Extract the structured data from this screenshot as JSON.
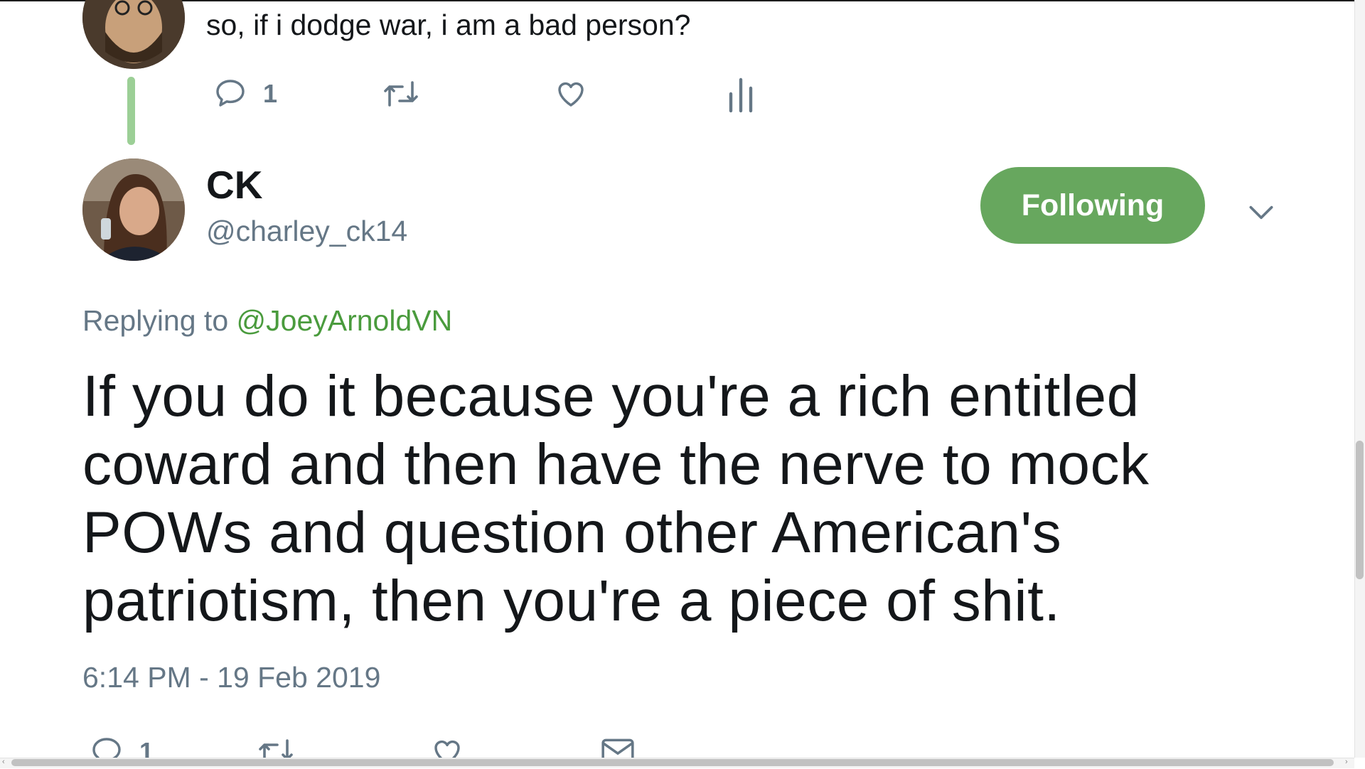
{
  "previous_tweet": {
    "text": "so, if i dodge war, i am a bad person?",
    "reply_count": "1"
  },
  "reply_tweet": {
    "display_name": "CK",
    "handle": "@charley_ck14",
    "follow_label": "Following",
    "replying_prefix": "Replying to ",
    "replying_to": "@JoeyArnoldVN",
    "text": "If you do it because you're a rich entitled coward and then have the nerve to mock POWs and question other American's patriotism, then you're a piece of shit.",
    "timestamp": "6:14 PM - 19 Feb 2019",
    "reply_count": "1"
  },
  "colors": {
    "accent_green": "#67a75e",
    "mention_green": "#4a9b3d",
    "thread_line": "#9ccf96",
    "secondary_text": "#657786"
  },
  "icons": {
    "previous_actions": [
      "reply-icon",
      "retweet-icon",
      "like-icon",
      "analytics-icon"
    ],
    "reply_actions": [
      "reply-icon",
      "retweet-icon",
      "like-icon",
      "dm-icon"
    ],
    "header": [
      "chevron-down-icon"
    ]
  }
}
